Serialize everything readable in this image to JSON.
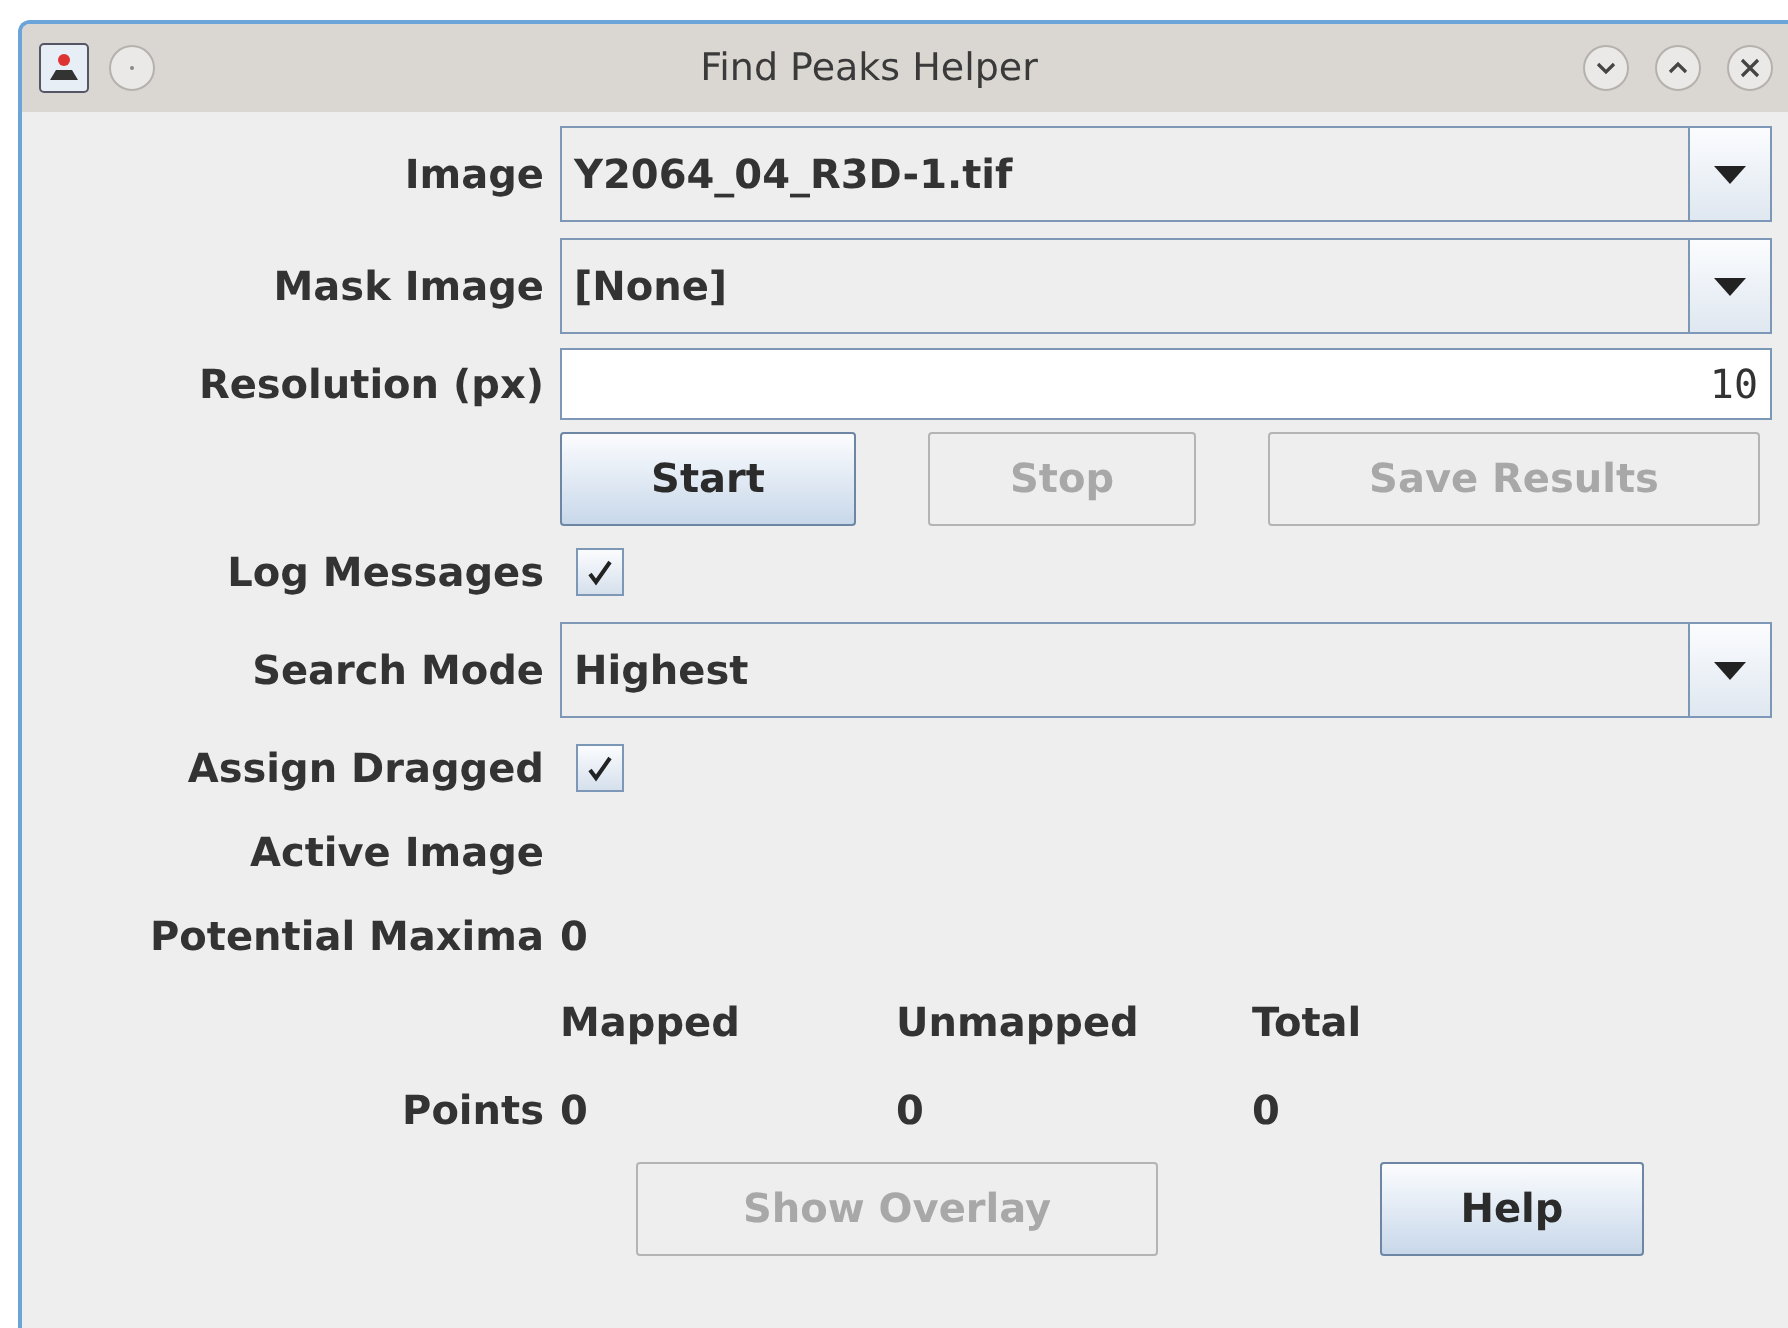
{
  "window": {
    "title": "Find Peaks Helper"
  },
  "rows": [
    {
      "kind": "combo",
      "label": "Image",
      "value": "Y2064_04_R3D-1.tif"
    },
    {
      "kind": "combo",
      "label": "Mask Image",
      "value": "[None]"
    },
    {
      "kind": "text",
      "label": "Resolution (px)",
      "value": "10"
    },
    {
      "kind": "buttons",
      "buttons": [
        {
          "label": "Start",
          "disabled": false
        },
        {
          "label": "Stop",
          "disabled": true
        },
        {
          "label": "Save Results",
          "disabled": true
        }
      ]
    },
    {
      "kind": "checkbox",
      "label": "Log Messages",
      "checked": true
    },
    {
      "kind": "combo",
      "label": "Search Mode",
      "value": "Highest"
    },
    {
      "kind": "checkbox",
      "label": "Assign Dragged",
      "checked": true
    },
    {
      "kind": "value",
      "label": "Active Image"
    },
    {
      "kind": "value",
      "label": "Potential Maxima",
      "value": "0"
    },
    {
      "kind": "table",
      "columns": [
        "Mapped",
        "Unmapped",
        "Total"
      ],
      "row_label": "Points",
      "values": [
        "0",
        "0",
        "0"
      ]
    },
    {
      "kind": "buttons",
      "buttons": [
        {
          "label": "Show Overlay",
          "disabled": true
        },
        {
          "label": "Help",
          "disabled": false
        }
      ]
    }
  ]
}
